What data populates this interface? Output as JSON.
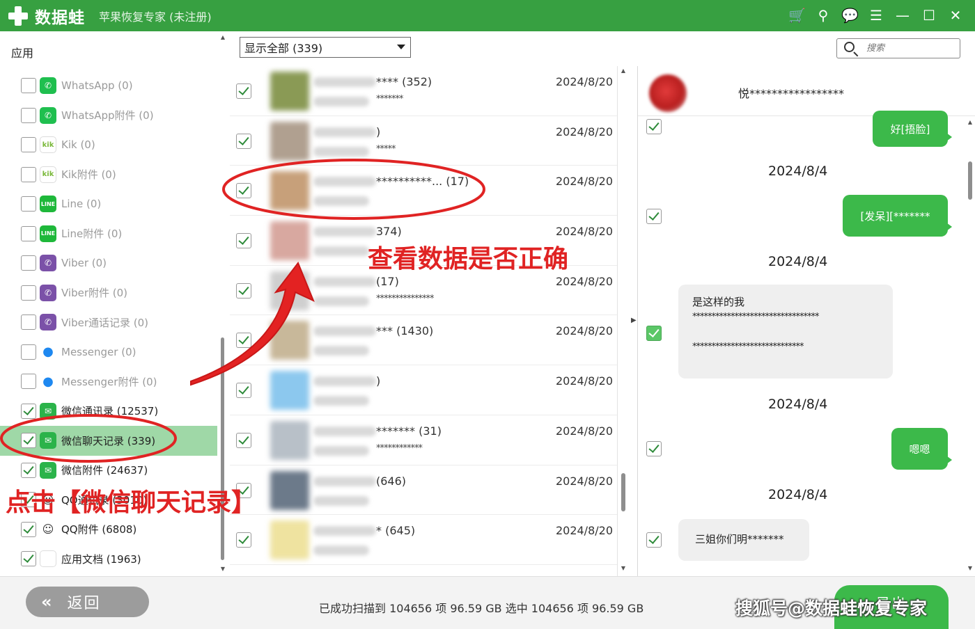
{
  "titlebar": {
    "app_name": "数据蛙",
    "subtitle": "苹果恢复专家 (未注册)",
    "icons": [
      "cart-icon",
      "key-icon",
      "chat-icon",
      "list-icon",
      "minimize-icon",
      "maximize-icon",
      "close-icon"
    ],
    "icon_glyphs": [
      "🛒",
      "⚲",
      "💬",
      "☰",
      "—",
      "☐",
      "✕"
    ],
    "accent": "#37a041"
  },
  "sidebar": {
    "header": "应用",
    "items": [
      {
        "label": "WhatsApp (0)",
        "icon": "whatsapp-icon",
        "glyph": "✆",
        "checked": false
      },
      {
        "label": "WhatsApp附件 (0)",
        "icon": "whatsapp-icon",
        "glyph": "✆",
        "checked": false
      },
      {
        "label": "Kik (0)",
        "icon": "kik-icon",
        "glyph": "kik",
        "checked": false
      },
      {
        "label": "Kik附件 (0)",
        "icon": "kik-icon",
        "glyph": "kik",
        "checked": false
      },
      {
        "label": "Line (0)",
        "icon": "line-icon",
        "glyph": "LINE",
        "checked": false
      },
      {
        "label": "Line附件 (0)",
        "icon": "line-icon",
        "glyph": "LINE",
        "checked": false
      },
      {
        "label": "Viber (0)",
        "icon": "viber-icon",
        "glyph": "✆",
        "checked": false
      },
      {
        "label": "Viber附件 (0)",
        "icon": "viber-icon",
        "glyph": "✆",
        "checked": false
      },
      {
        "label": "Viber通话记录 (0)",
        "icon": "viber-icon",
        "glyph": "✆",
        "checked": false
      },
      {
        "label": "Messenger (0)",
        "icon": "messenger-icon",
        "glyph": "●",
        "checked": false
      },
      {
        "label": "Messenger附件 (0)",
        "icon": "messenger-icon",
        "glyph": "●",
        "checked": false
      },
      {
        "label": "微信通讯录 (12537)",
        "icon": "wechat-icon",
        "glyph": "✉",
        "checked": true
      },
      {
        "label": "微信聊天记录 (339)",
        "icon": "wechat-icon",
        "glyph": "✉",
        "checked": true,
        "selected": true
      },
      {
        "label": "微信附件 (24637)",
        "icon": "wechat-icon",
        "glyph": "✉",
        "checked": true
      },
      {
        "label": "QQ通讯录 (3010)",
        "icon": "qq-icon",
        "glyph": "☺",
        "checked": true
      },
      {
        "label": "QQ附件 (6808)",
        "icon": "qq-icon",
        "glyph": "☺",
        "checked": true
      },
      {
        "label": "应用文档 (1963)",
        "icon": "document-icon",
        "glyph": "",
        "checked": true
      }
    ]
  },
  "filter": {
    "selected": "显示全部 (339)"
  },
  "search": {
    "placeholder": "搜索"
  },
  "conversations": [
    {
      "name": "**** (352)",
      "sub": "*******",
      "date": "2024/8/20",
      "avatar": "#8a9a55"
    },
    {
      "name": ")",
      "sub": "*****",
      "date": "2024/8/20",
      "avatar": "#b0a090"
    },
    {
      "name": "**********... (17)",
      "sub": "",
      "date": "2024/8/20",
      "avatar": "#c7a07a"
    },
    {
      "name": "374)",
      "sub": "",
      "date": "2024/8/20",
      "avatar": "#d8a8a0"
    },
    {
      "name": "(17)",
      "sub": "***************",
      "date": "2024/8/20",
      "avatar": "#cfcfcf"
    },
    {
      "name": "*** (1430)",
      "sub": "",
      "date": "2024/8/20",
      "avatar": "#c8b89a"
    },
    {
      "name": ")",
      "sub": "",
      "date": "2024/8/20",
      "avatar": "#8cc8ee"
    },
    {
      "name": "******* (31)",
      "sub": "************",
      "date": "2024/8/20",
      "avatar": "#b8c0c8"
    },
    {
      "name": "(646)",
      "sub": "",
      "date": "2024/8/20",
      "avatar": "#6c7a8a"
    },
    {
      "name": "* (645)",
      "sub": "",
      "date": "2024/8/20",
      "avatar": "#efe3a0"
    }
  ],
  "chat": {
    "contact_name": "悦*****************",
    "bubble_out_1": "好[捂脸]",
    "date_1": "2024/8/4",
    "bubble_out_2": "[发呆][*******",
    "date_2": "2024/8/4",
    "bubble_in_1": {
      "line1": "是这样的我",
      "line2": "*********************************",
      "line3": "*****************************"
    },
    "date_3": "2024/8/4",
    "bubble_out_3": "嗯嗯",
    "date_4": "2024/8/4",
    "bubble_in_2": "三姐你们明*******",
    "bubble_green": "#3cb94a"
  },
  "bottom": {
    "back_icon": "«",
    "back_label": "返回",
    "status": "已成功扫描到 104656 项 96.59 GB   选中 104656 项 96.59 GB",
    "export_label": "导出",
    "watermark": "搜狐号@数据蛙恢复专家"
  },
  "annotations": {
    "step1": "点击【微信聊天记录】",
    "step2": "查看数据是否正确",
    "color": "#e02323"
  }
}
